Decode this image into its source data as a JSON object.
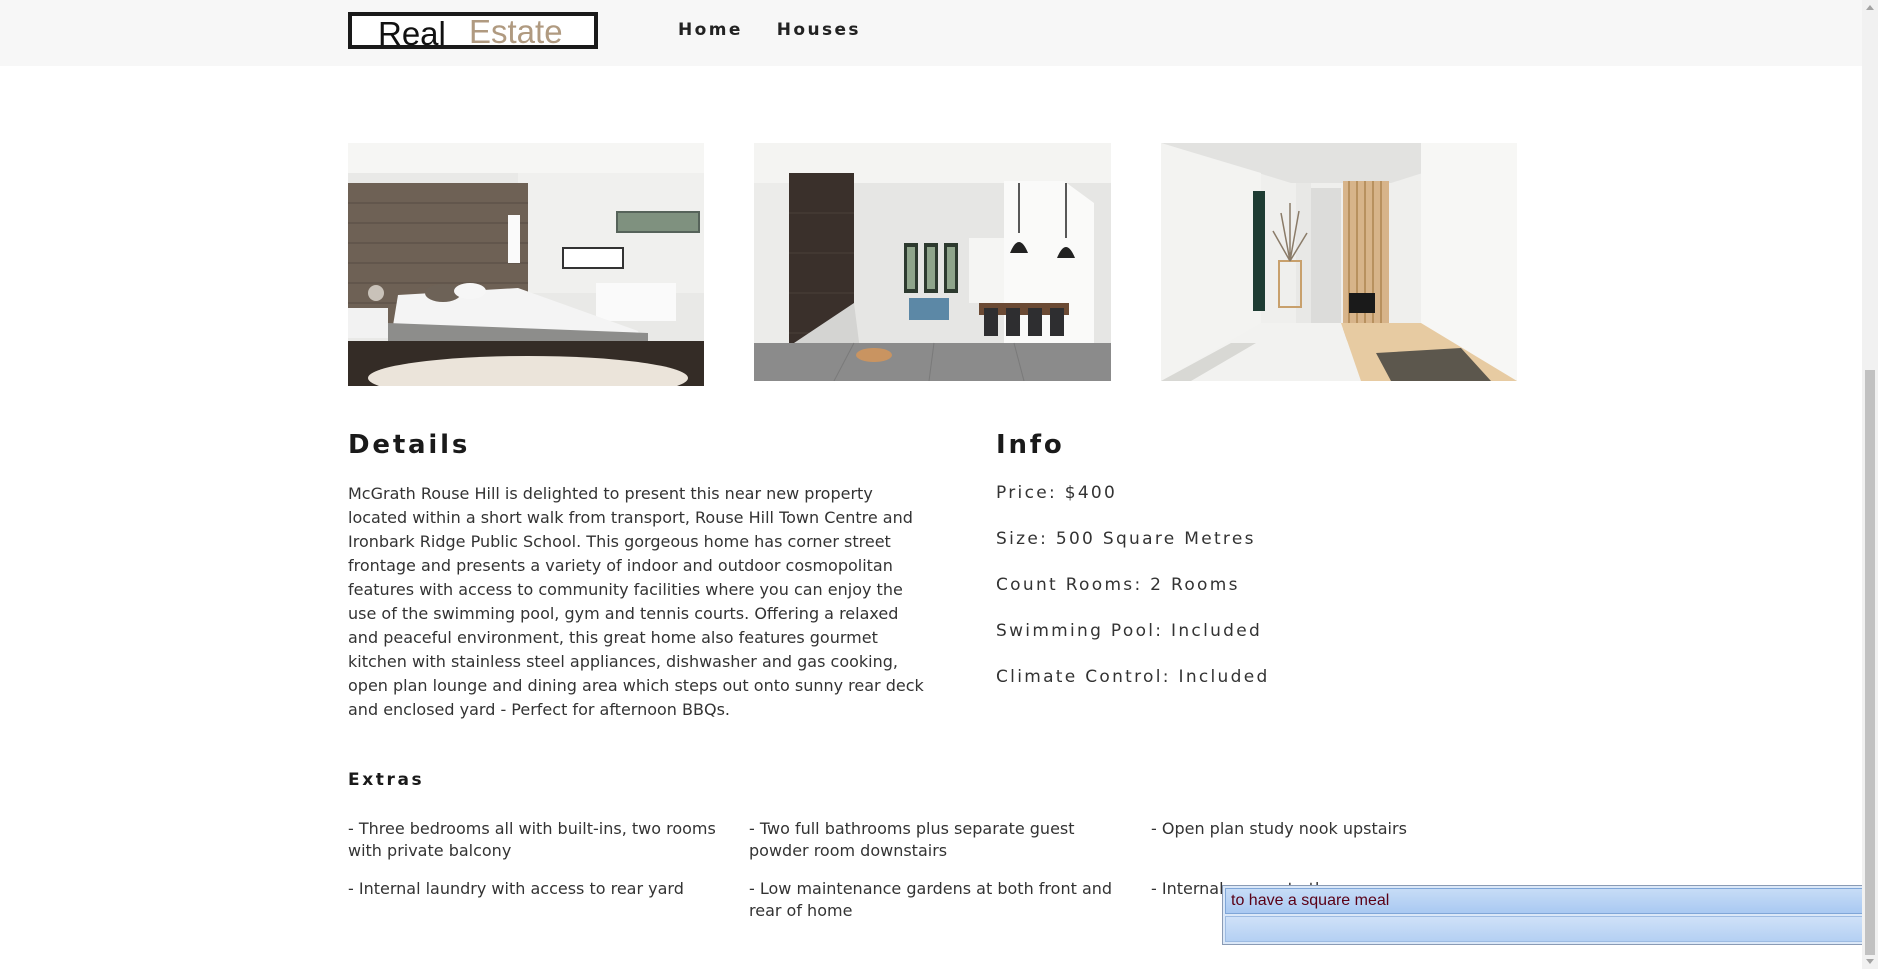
{
  "header": {
    "logo": {
      "word1": "Real",
      "word2": "Estate"
    },
    "nav": [
      {
        "label": "Home"
      },
      {
        "label": "Houses"
      }
    ]
  },
  "gallery": [
    {
      "icon": "bedroom-photo"
    },
    {
      "icon": "dining-room-photo"
    },
    {
      "icon": "hallway-photo"
    }
  ],
  "details": {
    "heading": "Details",
    "text": "McGrath Rouse Hill is delighted to present this near new property located within a short walk from transport, Rouse Hill Town Centre and Ironbark Ridge Public School. This gorgeous home has corner street frontage and presents a variety of indoor and outdoor cosmopolitan features with access to community facilities where you can enjoy the use of the swimming pool, gym and tennis courts. Offering a relaxed and peaceful environment, this great home also features gourmet kitchen with stainless steel appliances, dishwasher and gas cooking, open plan lounge and dining area which steps out onto sunny rear deck and enclosed yard - Perfect for afternoon BBQs."
  },
  "info": {
    "heading": "Info",
    "rows": [
      "Price: $400",
      "Size: 500 Square Metres",
      "Count Rooms: 2 Rooms",
      "Swimming Pool: Included",
      "Climate Control: Included"
    ]
  },
  "extras": {
    "heading": "Extras",
    "items": [
      "- Three bedrooms all with built-ins, two rooms with private balcony",
      "- Two full bathrooms plus separate guest powder room downstairs",
      "- Open plan study nook upstairs",
      "- Internal laundry with access to rear yard",
      "- Low maintenance gardens at both front and rear of home",
      "- Internal access to the garage"
    ]
  },
  "popup": {
    "suggestion": "to have a square meal"
  },
  "colors": {
    "logo_accent": "#b09a80",
    "header_bg": "#f7f7f7",
    "popup_text": "#5a0015"
  }
}
